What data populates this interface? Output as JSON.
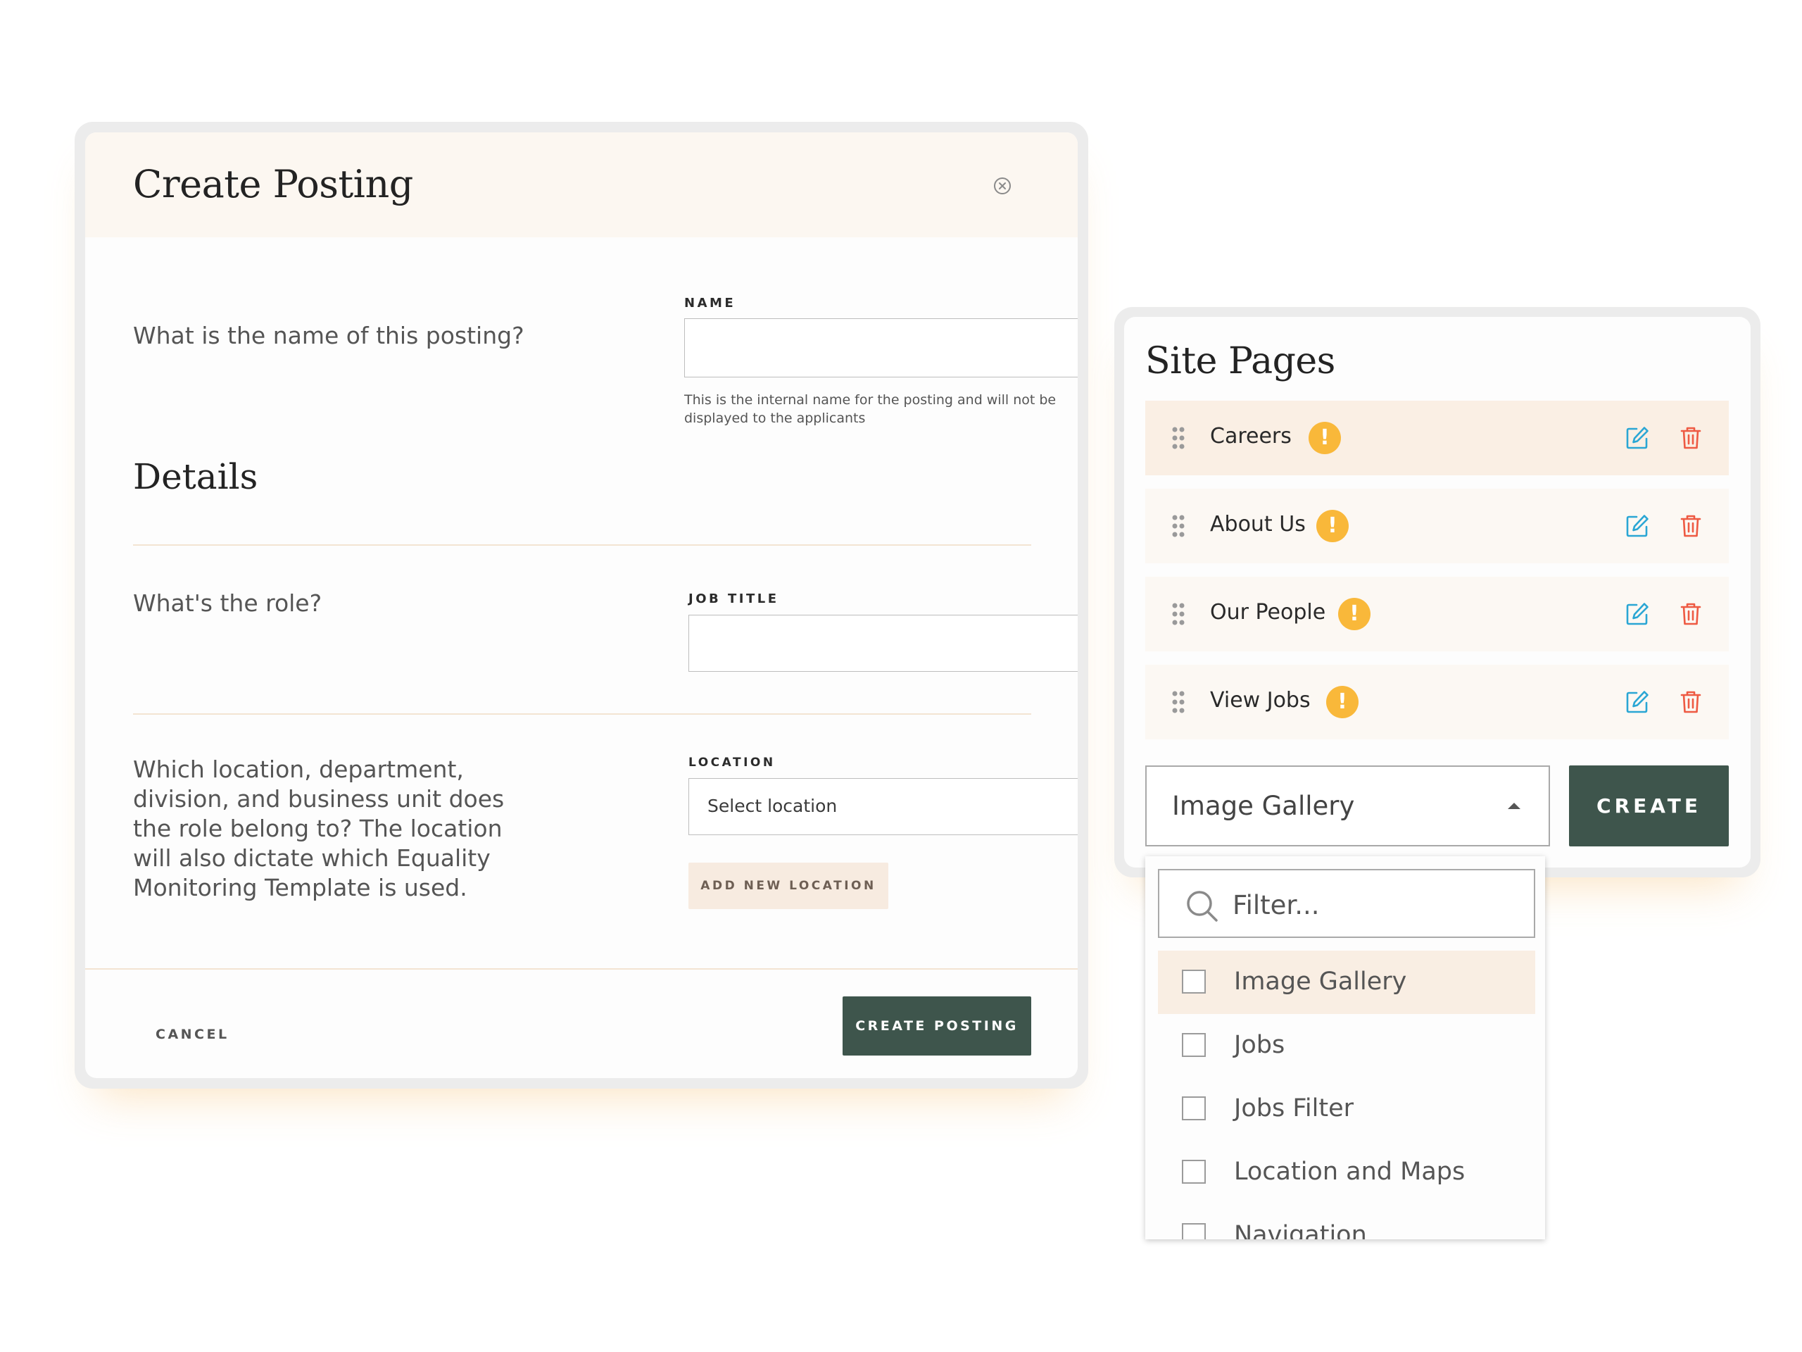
{
  "create_posting": {
    "title": "Create Posting",
    "name_question": "What is the name of this posting?",
    "name_label": "NAME",
    "name_value": "",
    "name_helper": "This is the internal name for the posting and will not be displayed to the applicants",
    "details_heading": "Details",
    "role_question": "What's the role?",
    "job_title_label": "JOB TITLE",
    "job_title_value": "",
    "location_question": "Which location, department, division, and business unit does the role belong to? The location will also dictate which Equality Monitoring Template is used.",
    "location_label": "LOCATION",
    "location_select_value": "Select location",
    "add_location_label": "ADD NEW LOCATION",
    "cancel_label": "CANCEL",
    "submit_label": "CREATE POSTING"
  },
  "site_pages": {
    "title": "Site Pages",
    "pages": [
      {
        "name": "Careers",
        "warning": "!",
        "active": true
      },
      {
        "name": "About Us",
        "warning": "!",
        "active": false
      },
      {
        "name": "Our People",
        "warning": "!",
        "active": false
      },
      {
        "name": "View Jobs",
        "warning": "!",
        "active": false
      }
    ],
    "widget_select_value": "Image Gallery",
    "create_label": "CREATE"
  },
  "dropdown": {
    "filter_placeholder": "Filter...",
    "options": [
      {
        "label": "Image Gallery",
        "checked": false,
        "highlighted": true
      },
      {
        "label": "Jobs",
        "checked": false,
        "highlighted": false
      },
      {
        "label": "Jobs Filter",
        "checked": false,
        "highlighted": false
      },
      {
        "label": "Location and Maps",
        "checked": false,
        "highlighted": false
      },
      {
        "label": "Navigation",
        "checked": false,
        "highlighted": false
      }
    ]
  },
  "colors": {
    "primary_button": "#3e554c",
    "header_bg": "#fcf7f1",
    "row_bg": "#fcf8f3",
    "row_active_bg": "#faefe4",
    "warning": "#f9b83a",
    "edit_icon": "#2aa6d4",
    "delete_icon": "#ee5a43",
    "divider": "#f3e4d2"
  },
  "icons": {
    "close": "close-circle-icon",
    "drag": "drag-handle-icon",
    "warning": "warning-icon",
    "edit": "edit-icon",
    "delete": "trash-icon",
    "search": "search-icon",
    "caret_down": "caret-down-icon",
    "caret_up": "caret-up-icon"
  }
}
